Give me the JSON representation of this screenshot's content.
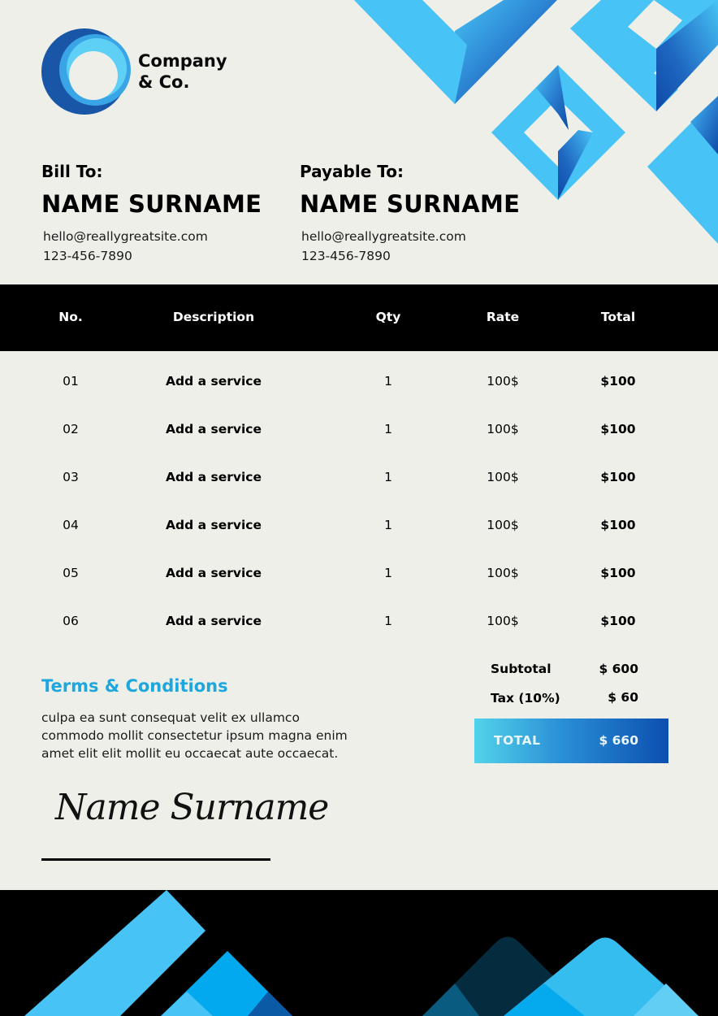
{
  "company": {
    "name_line1": "Company",
    "name_line2": "& Co.",
    "logo_icon": "concentric-circle-logo-icon"
  },
  "bill_to": {
    "label": "Bill To:",
    "name": "NAME SURNAME",
    "email": "hello@reallygreatsite.com",
    "phone": "123-456-7890"
  },
  "payable_to": {
    "label": "Payable To:",
    "name": "NAME SURNAME",
    "email": "hello@reallygreatsite.com",
    "phone": "123-456-7890"
  },
  "table": {
    "headers": {
      "no": "No.",
      "description": "Description",
      "qty": "Qty",
      "rate": "Rate",
      "total": "Total"
    },
    "rows": [
      {
        "no": "01",
        "description": "Add a service",
        "qty": "1",
        "rate": "100$",
        "total": "$100"
      },
      {
        "no": "02",
        "description": "Add a service",
        "qty": "1",
        "rate": "100$",
        "total": "$100"
      },
      {
        "no": "03",
        "description": "Add a service",
        "qty": "1",
        "rate": "100$",
        "total": "$100"
      },
      {
        "no": "04",
        "description": "Add a service",
        "qty": "1",
        "rate": "100$",
        "total": "$100"
      },
      {
        "no": "05",
        "description": "Add a service",
        "qty": "1",
        "rate": "100$",
        "total": "$100"
      },
      {
        "no": "06",
        "description": "Add a service",
        "qty": "1",
        "rate": "100$",
        "total": "$100"
      }
    ]
  },
  "terms": {
    "title": "Terms & Conditions",
    "line1": "culpa ea sunt consequat velit ex ullamco",
    "line2": "commodo mollit consectetur ipsum magna enim",
    "line3": "amet elit elit mollit eu occaecat aute occaecat."
  },
  "summary": {
    "subtotal_label": "Subtotal",
    "subtotal_value": "$ 600",
    "tax_label": "Tax (10%)",
    "tax_value": "$ 60",
    "total_label": "TOTAL",
    "total_value": "$ 660"
  },
  "signature": {
    "name": "Name Surname"
  },
  "colors": {
    "background": "#efefe9",
    "accent_blue": "#1ea7dc",
    "shape_light_blue": "#47c3f5",
    "shape_dark_blue": "#0c4fb0",
    "table_header": "#000000"
  }
}
